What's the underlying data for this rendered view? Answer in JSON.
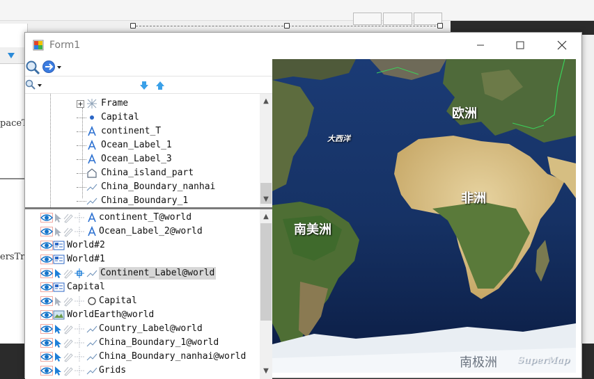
{
  "window": {
    "title": "Form1",
    "minimize_icon": "minimize-icon",
    "maximize_icon": "maximize-icon",
    "close_icon": "close-icon"
  },
  "designer": {
    "left_labels": [
      "paceT",
      "ersTr"
    ]
  },
  "toolbar1": {
    "icons": [
      "search-icon",
      "navigate-circle-icon",
      "dropdown-arrow-icon"
    ]
  },
  "toolbar2": {
    "icons": [
      "search-small-icon",
      "dropdown-arrow-icon",
      "move-down-icon",
      "move-up-icon"
    ]
  },
  "theme_tree": {
    "items": [
      {
        "label": "Frame",
        "icon": "frame-icon",
        "expandable": true
      },
      {
        "label": "Capital",
        "icon": "point-icon"
      },
      {
        "label": "continent_T",
        "icon": "text-layer-icon"
      },
      {
        "label": "Ocean_Label_1",
        "icon": "text-layer-icon"
      },
      {
        "label": "Ocean_Label_3",
        "icon": "text-layer-icon"
      },
      {
        "label": "China_island_part",
        "icon": "region-layer-icon"
      },
      {
        "label": "China_Boundary_nanhai",
        "icon": "line-layer-icon"
      },
      {
        "label": "China_Boundary_1",
        "icon": "line-layer-icon"
      }
    ]
  },
  "layer_tree": {
    "items": [
      {
        "label": "continent_T@world",
        "indent": 1,
        "icon": "text-layer-icon",
        "selected": false
      },
      {
        "label": "Ocean_Label_2@world",
        "indent": 1,
        "icon": "text-layer-icon",
        "selected": false
      },
      {
        "label": "World#2",
        "indent": 0,
        "icon": "theme-group-icon",
        "selected": false
      },
      {
        "label": "World#1",
        "indent": 0,
        "icon": "theme-group-icon",
        "selected": false
      },
      {
        "label": "Continent_Label@world",
        "indent": 1,
        "icon": "line-layer-icon",
        "selected": true
      },
      {
        "label": "Capital",
        "indent": 0,
        "icon": "theme-group-icon",
        "selected": false
      },
      {
        "label": "Capital",
        "indent": 1,
        "icon": "point-circle-icon",
        "selected": false
      },
      {
        "label": "WorldEarth@world",
        "indent": 0,
        "icon": "image-layer-icon",
        "selected": false
      },
      {
        "label": "Country_Label@world",
        "indent": 1,
        "icon": "line-layer-icon",
        "selected": false
      },
      {
        "label": "China_Boundary_1@world",
        "indent": 1,
        "icon": "line-layer-icon",
        "selected": false
      },
      {
        "label": "China_Boundary_nanhai@world",
        "indent": 1,
        "icon": "line-layer-icon",
        "selected": false
      },
      {
        "label": "Grids",
        "indent": 1,
        "icon": "line-layer-icon",
        "selected": false
      }
    ]
  },
  "map": {
    "labels": {
      "europe": "欧洲",
      "atlantic": "大西洋",
      "africa": "非洲",
      "south_america": "南美洲",
      "antarctica": "南极洲"
    },
    "watermark": "SuperMap"
  },
  "colors": {
    "accent_blue": "#1e7fd8",
    "eye_blue": "#1473c9",
    "selection_gray": "#d7d7d7",
    "ocean": "#0f2a5c",
    "land": "#b59a6a"
  }
}
